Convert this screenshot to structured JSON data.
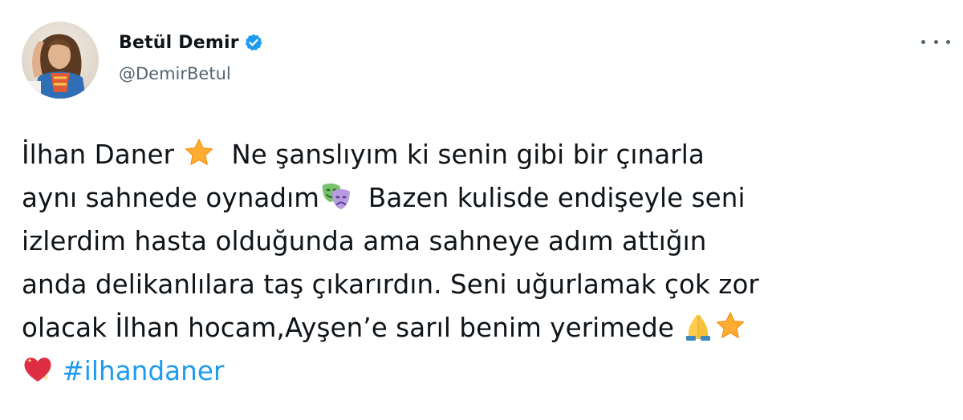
{
  "tweet": {
    "author": {
      "display_name": "Betül Demir",
      "handle": "@DemirBetul",
      "verified": true
    },
    "text_lines": [
      {
        "segments": [
          {
            "t": "İlhan Daner "
          },
          {
            "emoji": "star"
          },
          {
            "t": "  Ne şanslıyım ki senin gibi bir çınarla"
          }
        ]
      },
      {
        "segments": [
          {
            "t": "aynı sahnede oynadım"
          },
          {
            "emoji": "performing-arts"
          },
          {
            "t": "  Bazen kulisde endişeyle seni"
          }
        ]
      },
      {
        "segments": [
          {
            "t": "izlerdim hasta olduğunda ama sahneye adım attığın"
          }
        ]
      },
      {
        "segments": [
          {
            "t": "anda delikanlılara taş çıkarırdın. Seni uğurlamak çok zor"
          }
        ]
      },
      {
        "segments": [
          {
            "t": "olacak İlhan hocam,Ayşen’e sarıl benim yerimede "
          },
          {
            "emoji": "folded-hands"
          },
          {
            "emoji": "star"
          }
        ]
      }
    ],
    "line6": {
      "emoji": "sparkling-heart",
      "hashtag": "#ilhandaner"
    },
    "colors": {
      "text": "#0f1419",
      "secondary": "#536471",
      "link": "#1d9bf0",
      "verified_badge": "#1d9bf0"
    },
    "icons": [
      "verified-badge-icon",
      "more-options-icon",
      "star-emoji",
      "performing-arts-emoji",
      "folded-hands-emoji",
      "sparkling-heart-emoji"
    ]
  }
}
